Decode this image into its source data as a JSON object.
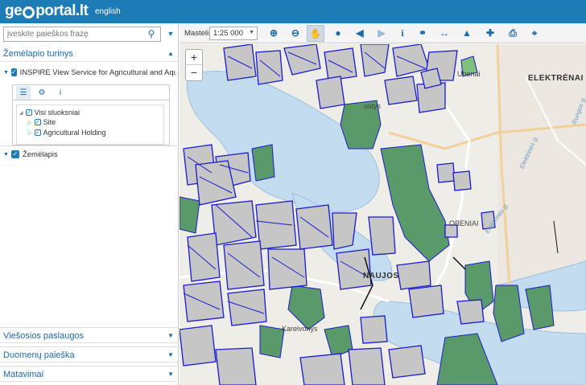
{
  "header": {
    "logo_text_a": "ge",
    "logo_text_b": "portal.lt",
    "lang_link": "english"
  },
  "sidebar": {
    "search_placeholder": "įveskite paieškos frazę",
    "map_content_title": "Žemėlapio turinys",
    "service_layer": "INSPIRE View Service for Agricultural and Aquaculture Fa",
    "tree": {
      "all_layers": "Visi sluoksniai",
      "site": "Site",
      "holding": "Agricultural Holding"
    },
    "basemap": "Žemėlapis",
    "sections": {
      "public_services": "Viešosios paslaugos",
      "data_search": "Duomenų paieška",
      "measurements": "Matavimai"
    }
  },
  "toolbar": {
    "scale_label": "Mastelis:",
    "scale_value": "1:25 000"
  },
  "map": {
    "labels": {
      "elektrenai": "ELEKTRĖNAI",
      "naujos": "NAUJOS",
      "kareivonys": "Kareivonys",
      "beniai": "OBENIAI",
      "ubenai": "Ubenai",
      "gustys": "ustys",
      "rungos": "Rungos g.",
      "elektrines1": "Elektrinės g.",
      "elektrines2": "Elektrinės g."
    },
    "zoom_in": "+",
    "zoom_out": "−"
  },
  "colors": {
    "header_bg": "#1d7bb5",
    "parcel_stroke": "#1a1ad0",
    "parcel_fill": "#5a9a6a",
    "water": "#c3dcef"
  }
}
